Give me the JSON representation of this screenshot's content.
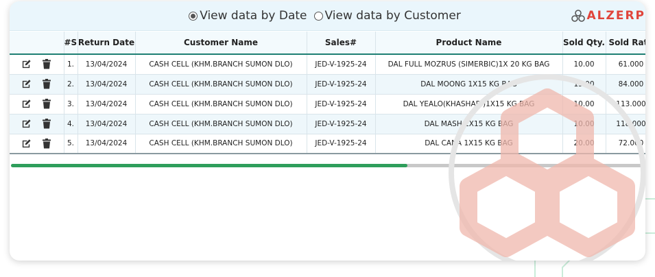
{
  "view_options": [
    {
      "label": "View data by Date",
      "selected": true
    },
    {
      "label": "View data by Customer",
      "selected": false
    }
  ],
  "logo": {
    "text": "ALZERP",
    "icon": "alzerp-logo-icon",
    "color": "#e0443a"
  },
  "table": {
    "columns": [
      "",
      "#Sl",
      "Return Date",
      "Customer Name",
      "Sales#",
      "Product Name",
      "Sold Qty.",
      "Sold Rate"
    ],
    "rows": [
      {
        "sl": "1.",
        "date": "13/04/2024",
        "customer": "CASH CELL (KHM.BRANCH SUMON DLO)",
        "sales": "JED-V-1925-24",
        "product": "DAL FULL MOZRUS (SIMERBIC)1X 20 KG BAG",
        "qty": "10.00",
        "rate": "61.000"
      },
      {
        "sl": "2.",
        "date": "13/04/2024",
        "customer": "CASH CELL (KHM.BRANCH SUMON DLO)",
        "sales": "JED-V-1925-24",
        "product": "DAL MOONG 1X15 KG BAG",
        "qty": "15.00",
        "rate": "84.000"
      },
      {
        "sl": "3.",
        "date": "13/04/2024",
        "customer": "CASH CELL (KHM.BRANCH SUMON DLO)",
        "sales": "JED-V-1925-24",
        "product": "DAL YEALO(KHASHARI)1X15 KG BAG",
        "qty": "10.00",
        "rate": "113.000"
      },
      {
        "sl": "4.",
        "date": "13/04/2024",
        "customer": "CASH CELL (KHM.BRANCH SUMON DLO)",
        "sales": "JED-V-1925-24",
        "product": "DAL MASH 1X15 KG BAG",
        "qty": "10.00",
        "rate": "118.000"
      },
      {
        "sl": "5.",
        "date": "13/04/2024",
        "customer": "CASH CELL (KHM.BRANCH SUMON DLO)",
        "sales": "JED-V-1925-24",
        "product": "DAL CANA 1X15 KG BAG",
        "qty": "20.00",
        "rate": "72.000"
      }
    ],
    "row_actions": [
      {
        "name": "edit-icon"
      },
      {
        "name": "trash-icon"
      }
    ]
  },
  "scrollbar": {
    "position_fraction": 0.0,
    "visible_fraction": 0.625,
    "thumb_color": "#2e9e5b"
  },
  "colors": {
    "header_underline": "#1d7f72",
    "topbar_bg": "#eaf6fc",
    "row_alt": "#eef7fb"
  }
}
